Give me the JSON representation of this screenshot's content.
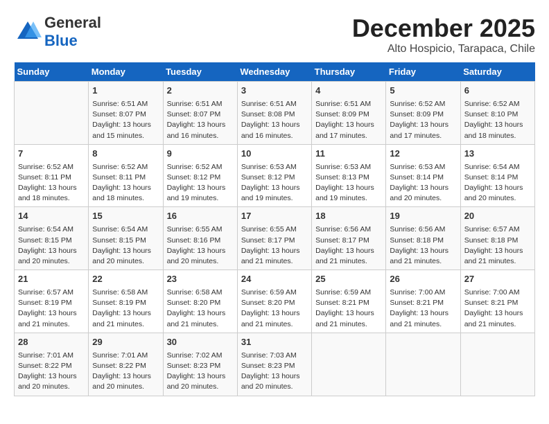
{
  "header": {
    "logo_general": "General",
    "logo_blue": "Blue",
    "month": "December 2025",
    "location": "Alto Hospicio, Tarapaca, Chile"
  },
  "weekdays": [
    "Sunday",
    "Monday",
    "Tuesday",
    "Wednesday",
    "Thursday",
    "Friday",
    "Saturday"
  ],
  "weeks": [
    [
      {
        "day": "",
        "info": ""
      },
      {
        "day": "1",
        "info": "Sunrise: 6:51 AM\nSunset: 8:07 PM\nDaylight: 13 hours\nand 15 minutes."
      },
      {
        "day": "2",
        "info": "Sunrise: 6:51 AM\nSunset: 8:07 PM\nDaylight: 13 hours\nand 16 minutes."
      },
      {
        "day": "3",
        "info": "Sunrise: 6:51 AM\nSunset: 8:08 PM\nDaylight: 13 hours\nand 16 minutes."
      },
      {
        "day": "4",
        "info": "Sunrise: 6:51 AM\nSunset: 8:09 PM\nDaylight: 13 hours\nand 17 minutes."
      },
      {
        "day": "5",
        "info": "Sunrise: 6:52 AM\nSunset: 8:09 PM\nDaylight: 13 hours\nand 17 minutes."
      },
      {
        "day": "6",
        "info": "Sunrise: 6:52 AM\nSunset: 8:10 PM\nDaylight: 13 hours\nand 18 minutes."
      }
    ],
    [
      {
        "day": "7",
        "info": "Sunrise: 6:52 AM\nSunset: 8:11 PM\nDaylight: 13 hours\nand 18 minutes."
      },
      {
        "day": "8",
        "info": "Sunrise: 6:52 AM\nSunset: 8:11 PM\nDaylight: 13 hours\nand 18 minutes."
      },
      {
        "day": "9",
        "info": "Sunrise: 6:52 AM\nSunset: 8:12 PM\nDaylight: 13 hours\nand 19 minutes."
      },
      {
        "day": "10",
        "info": "Sunrise: 6:53 AM\nSunset: 8:12 PM\nDaylight: 13 hours\nand 19 minutes."
      },
      {
        "day": "11",
        "info": "Sunrise: 6:53 AM\nSunset: 8:13 PM\nDaylight: 13 hours\nand 19 minutes."
      },
      {
        "day": "12",
        "info": "Sunrise: 6:53 AM\nSunset: 8:14 PM\nDaylight: 13 hours\nand 20 minutes."
      },
      {
        "day": "13",
        "info": "Sunrise: 6:54 AM\nSunset: 8:14 PM\nDaylight: 13 hours\nand 20 minutes."
      }
    ],
    [
      {
        "day": "14",
        "info": "Sunrise: 6:54 AM\nSunset: 8:15 PM\nDaylight: 13 hours\nand 20 minutes."
      },
      {
        "day": "15",
        "info": "Sunrise: 6:54 AM\nSunset: 8:15 PM\nDaylight: 13 hours\nand 20 minutes."
      },
      {
        "day": "16",
        "info": "Sunrise: 6:55 AM\nSunset: 8:16 PM\nDaylight: 13 hours\nand 20 minutes."
      },
      {
        "day": "17",
        "info": "Sunrise: 6:55 AM\nSunset: 8:17 PM\nDaylight: 13 hours\nand 21 minutes."
      },
      {
        "day": "18",
        "info": "Sunrise: 6:56 AM\nSunset: 8:17 PM\nDaylight: 13 hours\nand 21 minutes."
      },
      {
        "day": "19",
        "info": "Sunrise: 6:56 AM\nSunset: 8:18 PM\nDaylight: 13 hours\nand 21 minutes."
      },
      {
        "day": "20",
        "info": "Sunrise: 6:57 AM\nSunset: 8:18 PM\nDaylight: 13 hours\nand 21 minutes."
      }
    ],
    [
      {
        "day": "21",
        "info": "Sunrise: 6:57 AM\nSunset: 8:19 PM\nDaylight: 13 hours\nand 21 minutes."
      },
      {
        "day": "22",
        "info": "Sunrise: 6:58 AM\nSunset: 8:19 PM\nDaylight: 13 hours\nand 21 minutes."
      },
      {
        "day": "23",
        "info": "Sunrise: 6:58 AM\nSunset: 8:20 PM\nDaylight: 13 hours\nand 21 minutes."
      },
      {
        "day": "24",
        "info": "Sunrise: 6:59 AM\nSunset: 8:20 PM\nDaylight: 13 hours\nand 21 minutes."
      },
      {
        "day": "25",
        "info": "Sunrise: 6:59 AM\nSunset: 8:21 PM\nDaylight: 13 hours\nand 21 minutes."
      },
      {
        "day": "26",
        "info": "Sunrise: 7:00 AM\nSunset: 8:21 PM\nDaylight: 13 hours\nand 21 minutes."
      },
      {
        "day": "27",
        "info": "Sunrise: 7:00 AM\nSunset: 8:21 PM\nDaylight: 13 hours\nand 21 minutes."
      }
    ],
    [
      {
        "day": "28",
        "info": "Sunrise: 7:01 AM\nSunset: 8:22 PM\nDaylight: 13 hours\nand 20 minutes."
      },
      {
        "day": "29",
        "info": "Sunrise: 7:01 AM\nSunset: 8:22 PM\nDaylight: 13 hours\nand 20 minutes."
      },
      {
        "day": "30",
        "info": "Sunrise: 7:02 AM\nSunset: 8:23 PM\nDaylight: 13 hours\nand 20 minutes."
      },
      {
        "day": "31",
        "info": "Sunrise: 7:03 AM\nSunset: 8:23 PM\nDaylight: 13 hours\nand 20 minutes."
      },
      {
        "day": "",
        "info": ""
      },
      {
        "day": "",
        "info": ""
      },
      {
        "day": "",
        "info": ""
      }
    ]
  ]
}
